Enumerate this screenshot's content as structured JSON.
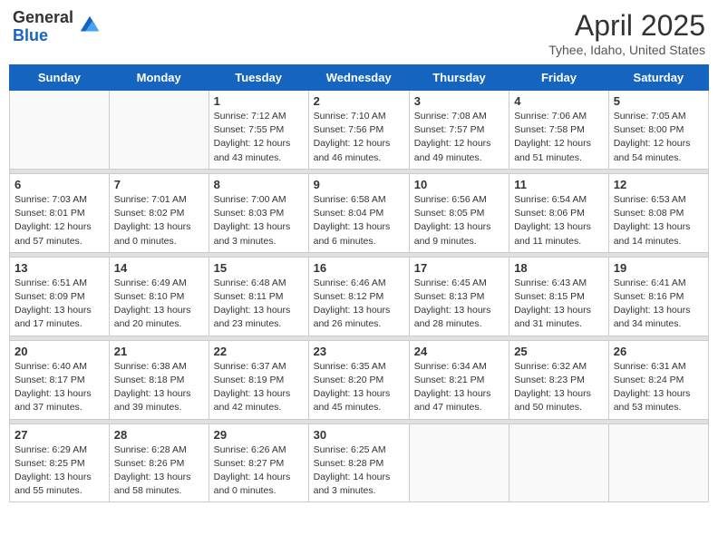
{
  "header": {
    "logo_general": "General",
    "logo_blue": "Blue",
    "title": "April 2025",
    "location": "Tyhee, Idaho, United States"
  },
  "weekdays": [
    "Sunday",
    "Monday",
    "Tuesday",
    "Wednesday",
    "Thursday",
    "Friday",
    "Saturday"
  ],
  "weeks": [
    [
      {
        "day": "",
        "info": ""
      },
      {
        "day": "",
        "info": ""
      },
      {
        "day": "1",
        "info": "Sunrise: 7:12 AM\nSunset: 7:55 PM\nDaylight: 12 hours and 43 minutes."
      },
      {
        "day": "2",
        "info": "Sunrise: 7:10 AM\nSunset: 7:56 PM\nDaylight: 12 hours and 46 minutes."
      },
      {
        "day": "3",
        "info": "Sunrise: 7:08 AM\nSunset: 7:57 PM\nDaylight: 12 hours and 49 minutes."
      },
      {
        "day": "4",
        "info": "Sunrise: 7:06 AM\nSunset: 7:58 PM\nDaylight: 12 hours and 51 minutes."
      },
      {
        "day": "5",
        "info": "Sunrise: 7:05 AM\nSunset: 8:00 PM\nDaylight: 12 hours and 54 minutes."
      }
    ],
    [
      {
        "day": "6",
        "info": "Sunrise: 7:03 AM\nSunset: 8:01 PM\nDaylight: 12 hours and 57 minutes."
      },
      {
        "day": "7",
        "info": "Sunrise: 7:01 AM\nSunset: 8:02 PM\nDaylight: 13 hours and 0 minutes."
      },
      {
        "day": "8",
        "info": "Sunrise: 7:00 AM\nSunset: 8:03 PM\nDaylight: 13 hours and 3 minutes."
      },
      {
        "day": "9",
        "info": "Sunrise: 6:58 AM\nSunset: 8:04 PM\nDaylight: 13 hours and 6 minutes."
      },
      {
        "day": "10",
        "info": "Sunrise: 6:56 AM\nSunset: 8:05 PM\nDaylight: 13 hours and 9 minutes."
      },
      {
        "day": "11",
        "info": "Sunrise: 6:54 AM\nSunset: 8:06 PM\nDaylight: 13 hours and 11 minutes."
      },
      {
        "day": "12",
        "info": "Sunrise: 6:53 AM\nSunset: 8:08 PM\nDaylight: 13 hours and 14 minutes."
      }
    ],
    [
      {
        "day": "13",
        "info": "Sunrise: 6:51 AM\nSunset: 8:09 PM\nDaylight: 13 hours and 17 minutes."
      },
      {
        "day": "14",
        "info": "Sunrise: 6:49 AM\nSunset: 8:10 PM\nDaylight: 13 hours and 20 minutes."
      },
      {
        "day": "15",
        "info": "Sunrise: 6:48 AM\nSunset: 8:11 PM\nDaylight: 13 hours and 23 minutes."
      },
      {
        "day": "16",
        "info": "Sunrise: 6:46 AM\nSunset: 8:12 PM\nDaylight: 13 hours and 26 minutes."
      },
      {
        "day": "17",
        "info": "Sunrise: 6:45 AM\nSunset: 8:13 PM\nDaylight: 13 hours and 28 minutes."
      },
      {
        "day": "18",
        "info": "Sunrise: 6:43 AM\nSunset: 8:15 PM\nDaylight: 13 hours and 31 minutes."
      },
      {
        "day": "19",
        "info": "Sunrise: 6:41 AM\nSunset: 8:16 PM\nDaylight: 13 hours and 34 minutes."
      }
    ],
    [
      {
        "day": "20",
        "info": "Sunrise: 6:40 AM\nSunset: 8:17 PM\nDaylight: 13 hours and 37 minutes."
      },
      {
        "day": "21",
        "info": "Sunrise: 6:38 AM\nSunset: 8:18 PM\nDaylight: 13 hours and 39 minutes."
      },
      {
        "day": "22",
        "info": "Sunrise: 6:37 AM\nSunset: 8:19 PM\nDaylight: 13 hours and 42 minutes."
      },
      {
        "day": "23",
        "info": "Sunrise: 6:35 AM\nSunset: 8:20 PM\nDaylight: 13 hours and 45 minutes."
      },
      {
        "day": "24",
        "info": "Sunrise: 6:34 AM\nSunset: 8:21 PM\nDaylight: 13 hours and 47 minutes."
      },
      {
        "day": "25",
        "info": "Sunrise: 6:32 AM\nSunset: 8:23 PM\nDaylight: 13 hours and 50 minutes."
      },
      {
        "day": "26",
        "info": "Sunrise: 6:31 AM\nSunset: 8:24 PM\nDaylight: 13 hours and 53 minutes."
      }
    ],
    [
      {
        "day": "27",
        "info": "Sunrise: 6:29 AM\nSunset: 8:25 PM\nDaylight: 13 hours and 55 minutes."
      },
      {
        "day": "28",
        "info": "Sunrise: 6:28 AM\nSunset: 8:26 PM\nDaylight: 13 hours and 58 minutes."
      },
      {
        "day": "29",
        "info": "Sunrise: 6:26 AM\nSunset: 8:27 PM\nDaylight: 14 hours and 0 minutes."
      },
      {
        "day": "30",
        "info": "Sunrise: 6:25 AM\nSunset: 8:28 PM\nDaylight: 14 hours and 3 minutes."
      },
      {
        "day": "",
        "info": ""
      },
      {
        "day": "",
        "info": ""
      },
      {
        "day": "",
        "info": ""
      }
    ]
  ]
}
